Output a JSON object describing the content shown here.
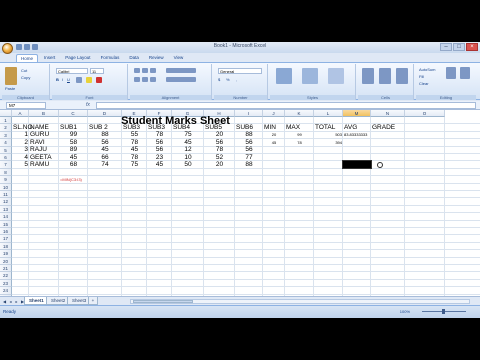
{
  "window": {
    "title": "Book1 - Microsoft Excel"
  },
  "ribbon_tabs": [
    "Home",
    "Insert",
    "Page Layout",
    "Formulas",
    "Data",
    "Review",
    "View"
  ],
  "ribbon": {
    "clipboard": {
      "label": "Clipboard",
      "paste": "Paste",
      "cut": "Cut",
      "copy": "Copy"
    },
    "font": {
      "label": "Font",
      "name": "Calibri",
      "size": "11"
    },
    "alignment": {
      "label": "Alignment"
    },
    "number": {
      "label": "Number",
      "format": "General"
    },
    "styles": {
      "label": "Styles"
    },
    "cells": {
      "label": "Cells"
    },
    "editing": {
      "label": "Editing",
      "autosum": "AutoSum",
      "fill": "Fill",
      "clear": "Clear",
      "sort": "Sort & Filter",
      "find": "Find & Select"
    }
  },
  "formula_bar": {
    "name_box": "M7",
    "fx": "fx",
    "content": ""
  },
  "columns": [
    "A",
    "B",
    "C",
    "D",
    "E",
    "F",
    "G",
    "H",
    "I",
    "J",
    "K",
    "L",
    "M",
    "N",
    "O"
  ],
  "rows": [
    "1",
    "2",
    "3",
    "4",
    "5",
    "6",
    "7",
    "8",
    "9",
    "10",
    "11",
    "12",
    "13",
    "14",
    "15",
    "16",
    "17",
    "18",
    "19",
    "20",
    "21",
    "22",
    "23",
    "24",
    "25",
    "26",
    "27",
    "28",
    "29",
    "30"
  ],
  "sheet": {
    "title": "Student Marks Sheet",
    "headers": [
      "SL.NO",
      "NAME",
      "SUB1",
      "SUB 2",
      "SUB3",
      "SUB3",
      "SUB4",
      "SUB5",
      "SUB6",
      "MIN",
      "MAX",
      "TOTAL",
      "AVG",
      "GRADE"
    ],
    "students": [
      {
        "sl": "1",
        "name": "GURU",
        "marks": [
          "99",
          "88",
          "55",
          "78",
          "75",
          "20",
          "88"
        ],
        "min": "20",
        "max": "99",
        "total": "503",
        "avg": "83.83333333"
      },
      {
        "sl": "2",
        "name": "RAVI",
        "marks": [
          "58",
          "56",
          "78",
          "56",
          "45",
          "56",
          "56"
        ],
        "min": "45",
        "max": "78",
        "total": "394",
        "avg": ""
      },
      {
        "sl": "3",
        "name": "RAJU",
        "marks": [
          "89",
          "45",
          "45",
          "56",
          "12",
          "78",
          "56"
        ],
        "min": "",
        "max": "",
        "total": "",
        "avg": ""
      },
      {
        "sl": "4",
        "name": "GEETA",
        "marks": [
          "45",
          "66",
          "78",
          "23",
          "10",
          "52",
          "77"
        ],
        "min": "",
        "max": "",
        "total": "",
        "avg": ""
      },
      {
        "sl": "5",
        "name": "RAMU",
        "marks": [
          "68",
          "74",
          "75",
          "45",
          "50",
          "20",
          "88"
        ],
        "min": "",
        "max": "",
        "total": "",
        "avg": ""
      }
    ],
    "note": "=MIN(C3:I3)"
  },
  "sheet_tabs": [
    "Sheet1",
    "Sheet2",
    "Sheet3"
  ],
  "status": {
    "text": "Ready",
    "zoom": "100%"
  }
}
